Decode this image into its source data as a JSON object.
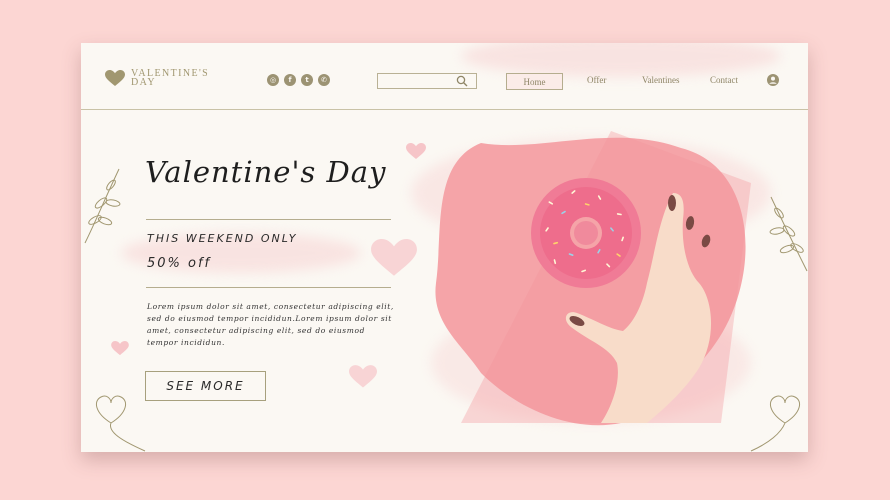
{
  "colors": {
    "background": "#fcd6d3",
    "page": "#fbf8f3",
    "gold": "#a19770",
    "pink": "#f5a0a5",
    "donut": "#ee6d8c"
  },
  "logo": {
    "line1": "VALENTINE'S",
    "line2": "DAY",
    "icon": "heart-icon"
  },
  "socials": [
    {
      "name": "instagram-icon",
      "glyph": "◎"
    },
    {
      "name": "facebook-icon",
      "glyph": "f"
    },
    {
      "name": "twitter-icon",
      "glyph": "t"
    },
    {
      "name": "whatsapp-icon",
      "glyph": "✆"
    }
  ],
  "search": {
    "placeholder": "",
    "value": "",
    "icon": "search-icon"
  },
  "nav": {
    "home": "Home",
    "offer": "Offer",
    "valentines": "Valentines",
    "contact": "Contact",
    "account_icon": "user-icon"
  },
  "hero": {
    "title": "Valentine's Day",
    "promo_line1": "THIS WEEKEND ONLY",
    "promo_line2": "50% off",
    "body": "Lorem ipsum dolor sit amet, consectetur adipiscing elit, sed do eiusmod tempor incididun.Lorem ipsum dolor sit amet, consectetur adipiscing elit, sed do eiusmod tempor incididun.",
    "cta": "SEE MORE",
    "image": "pink-donut-in-hand"
  }
}
